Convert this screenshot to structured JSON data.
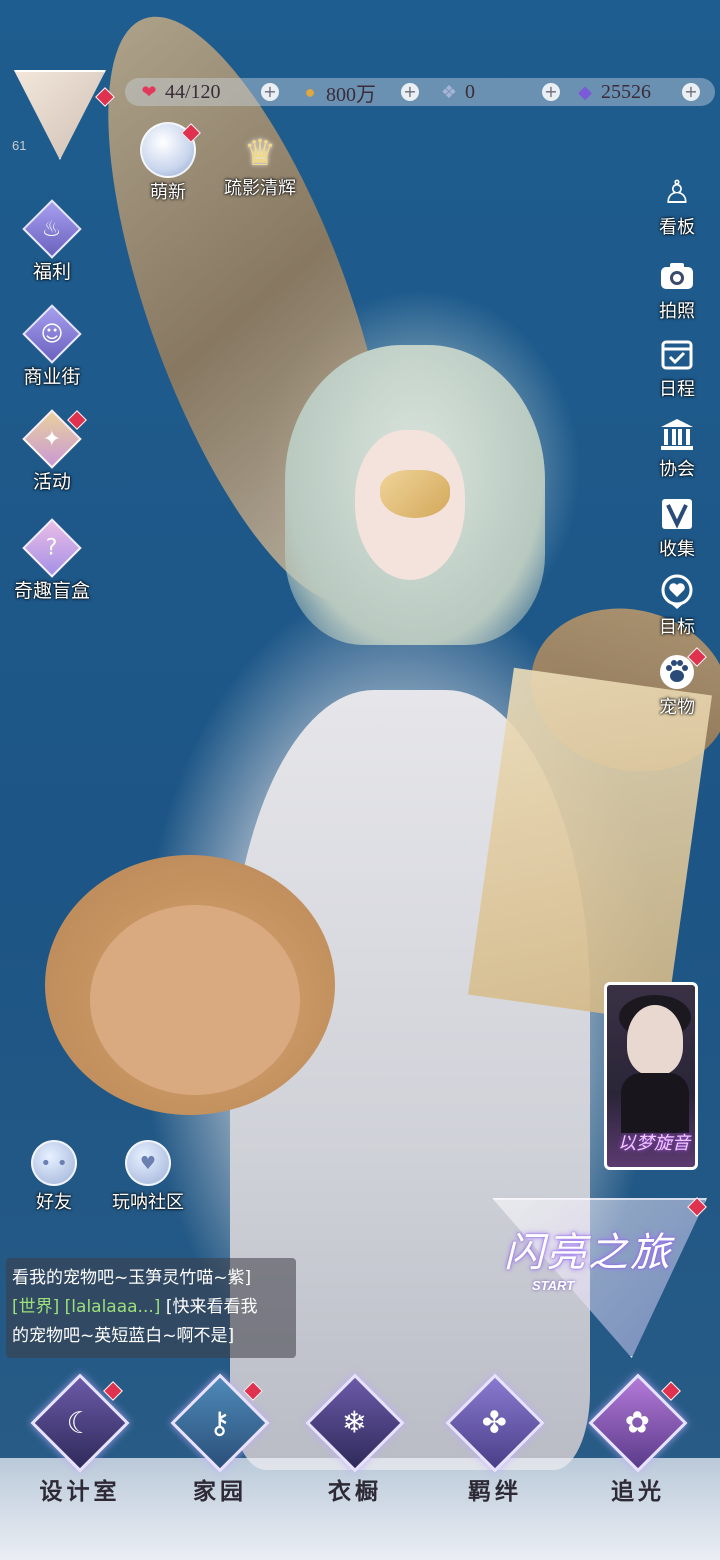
{
  "player": {
    "level": "61"
  },
  "resources": {
    "stamina": "44/120",
    "gold": "800万",
    "crystal": "0",
    "diamond": "25526"
  },
  "top_shortcuts": [
    {
      "label": "萌新"
    },
    {
      "label": "疏影清辉"
    }
  ],
  "left_menu": [
    {
      "label": "福利",
      "icon": "hot-air-balloon-icon"
    },
    {
      "label": "商业街",
      "icon": "shopping-bag-icon"
    },
    {
      "label": "活动",
      "icon": "stars-icon"
    },
    {
      "label": "奇趣盲盒",
      "icon": "gift-box-icon"
    }
  ],
  "right_menu": [
    {
      "label": "看板",
      "icon": "person-icon"
    },
    {
      "label": "拍照",
      "icon": "camera-icon"
    },
    {
      "label": "日程",
      "icon": "calendar-check-icon"
    },
    {
      "label": "协会",
      "icon": "building-icon"
    },
    {
      "label": "收集",
      "icon": "v-badge-icon"
    },
    {
      "label": "目标",
      "icon": "heart-medal-icon"
    },
    {
      "label": "宠物",
      "icon": "paw-icon"
    }
  ],
  "social": [
    {
      "label": "好友"
    },
    {
      "label": "玩呐社区"
    }
  ],
  "event_card": {
    "title": "以梦旋音"
  },
  "journey": {
    "title": "闪亮之旅",
    "subtitle": "START"
  },
  "chat": {
    "line1": "看我的宠物吧~玉笋灵竹喵~紫]",
    "channel": "[世界]",
    "sender": "[lalalaaa...]",
    "line2_msg": "[快来看看我",
    "line3": "的宠物吧~英短蓝白~啊不是]"
  },
  "bottom_nav": [
    {
      "label": "设计室",
      "icon": "moon-icon"
    },
    {
      "label": "家园",
      "icon": "key-icon"
    },
    {
      "label": "衣橱",
      "icon": "snowflake-icon"
    },
    {
      "label": "羁绊",
      "icon": "clover-icon"
    },
    {
      "label": "追光",
      "icon": "butterfly-icon"
    }
  ]
}
